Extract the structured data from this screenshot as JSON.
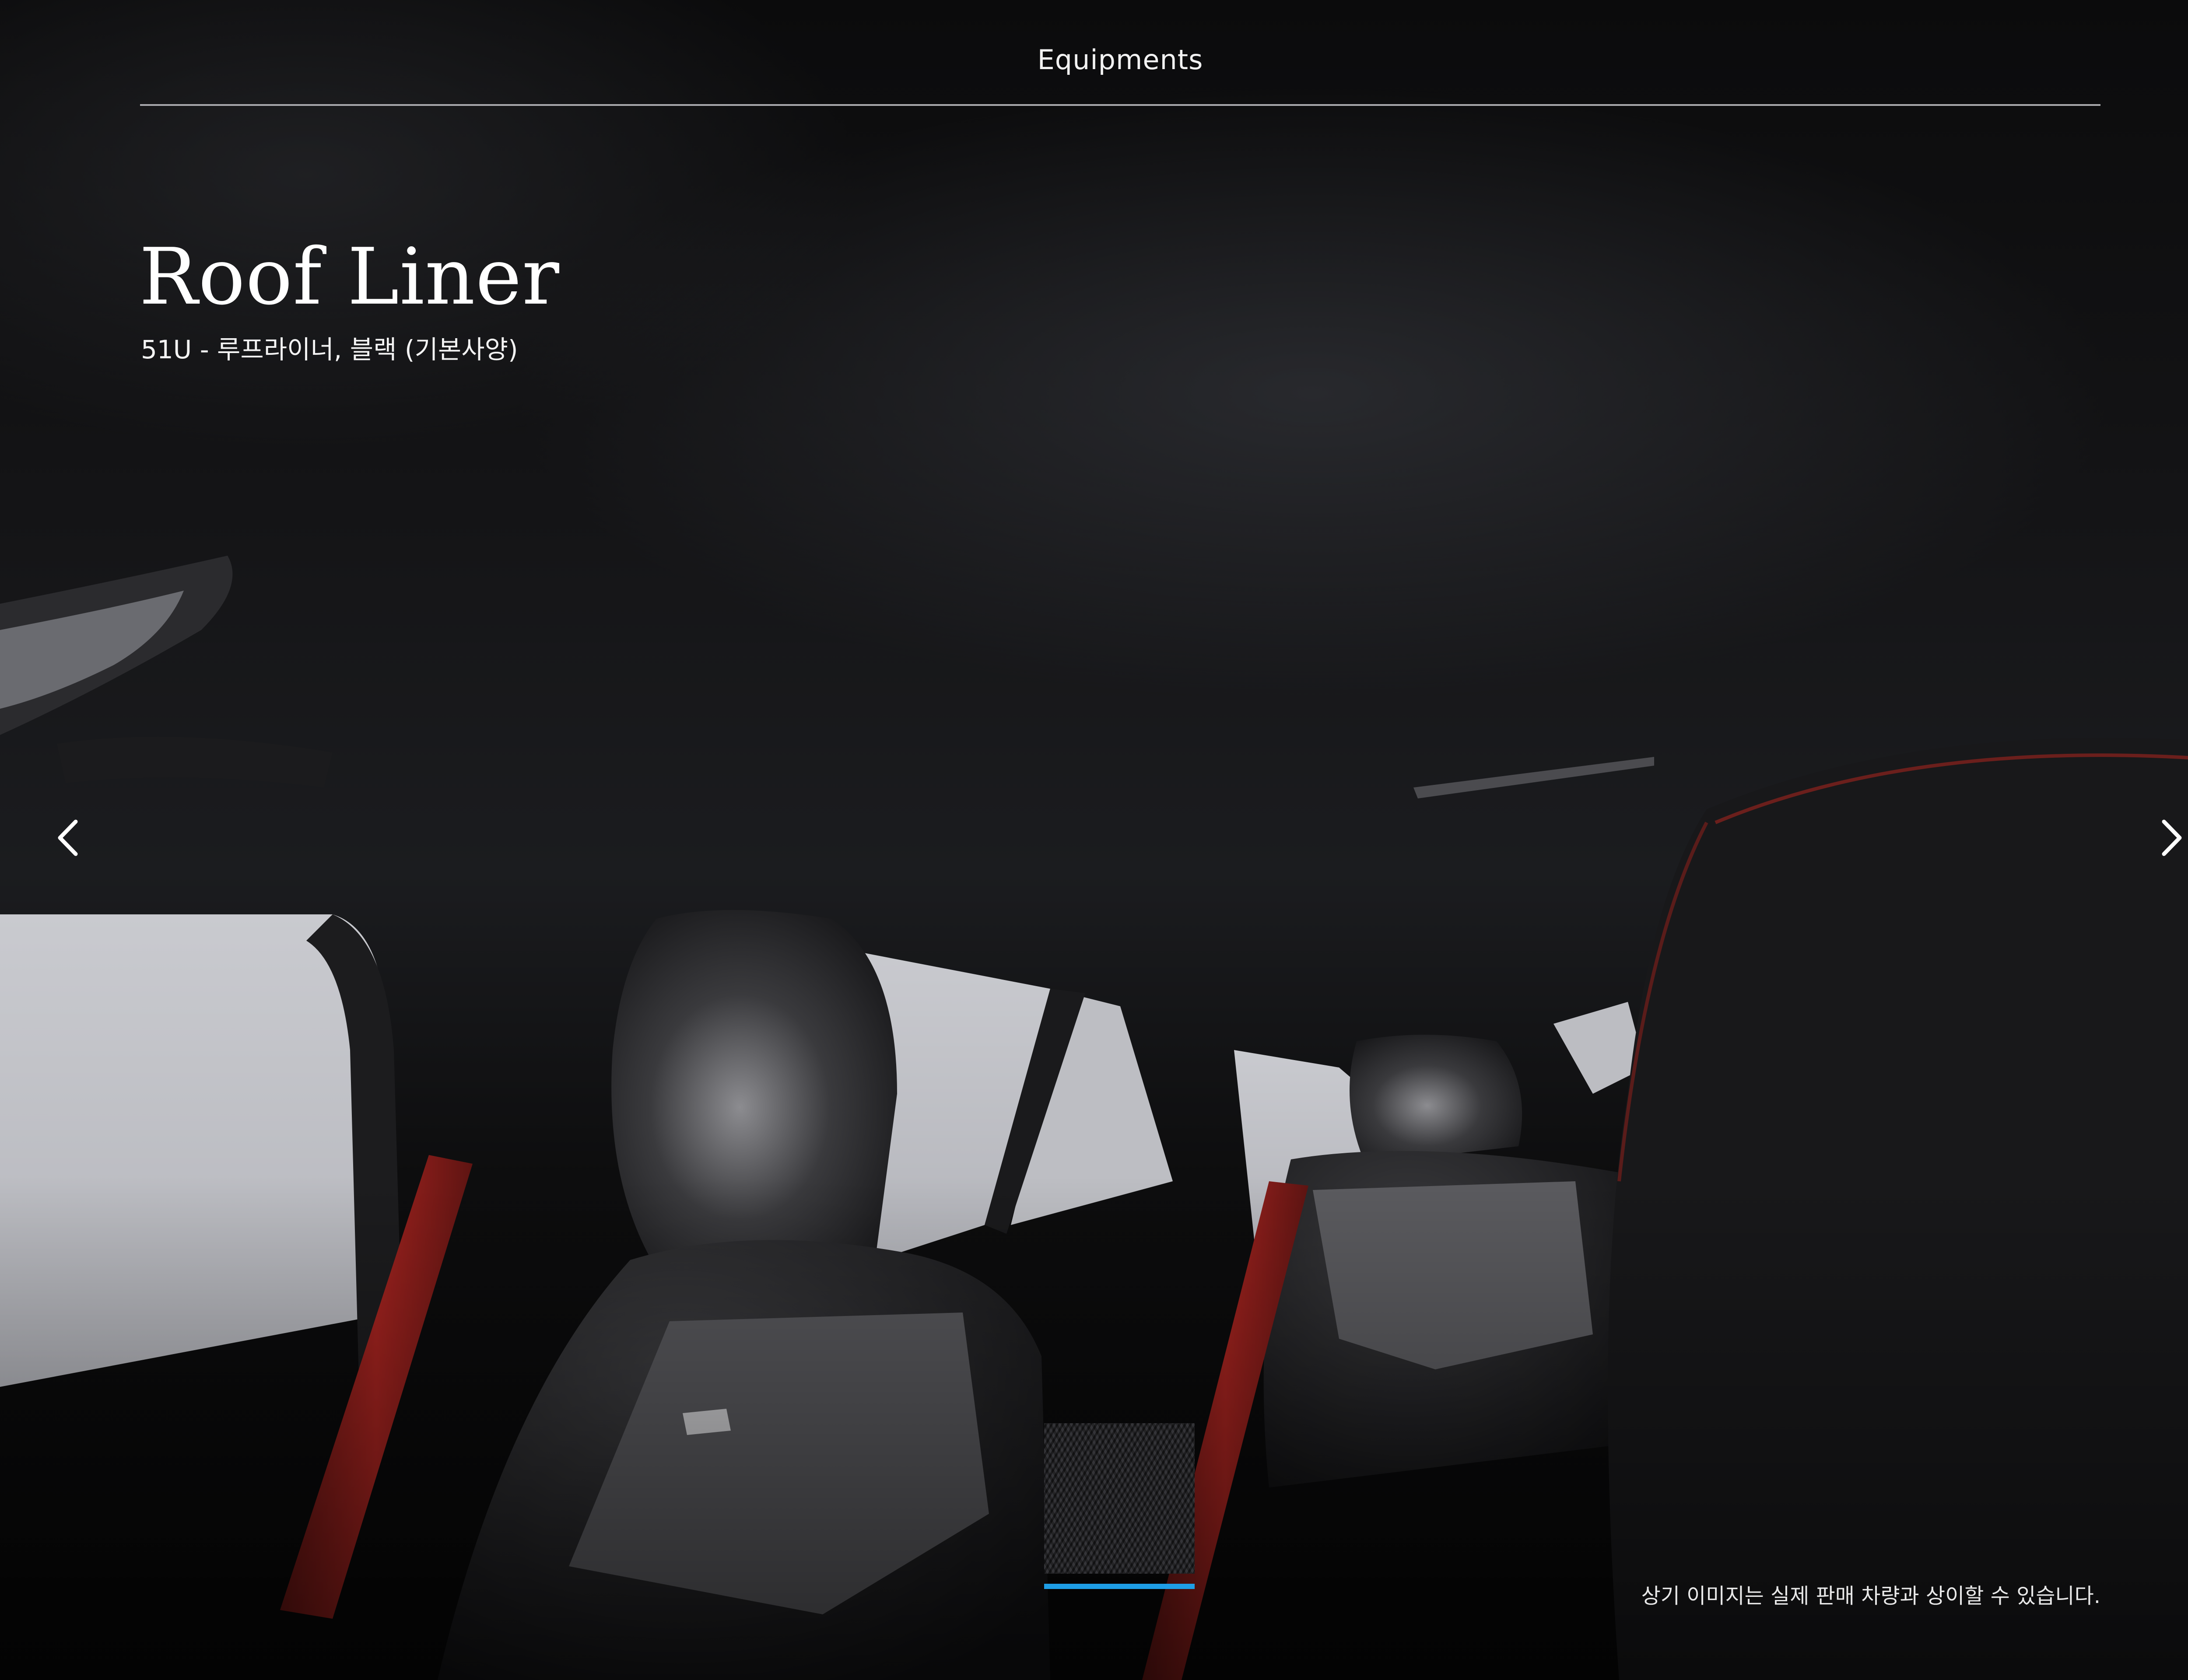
{
  "header": {
    "section_title": "Equipments"
  },
  "main": {
    "title": "Roof Liner",
    "option_code": "51U - 루프라이너, 블랙 (기본사양)",
    "disclaimer": "상기 이미지는 실제 판매 차량과 상이할 수 있습니다."
  },
  "carousel": {
    "prev_icon": "chevron-left-icon",
    "next_icon": "chevron-right-icon",
    "thumbnails": [
      {
        "name": "roof-liner-black-swatch",
        "selected": true
      }
    ],
    "indicator_color": "#1e9ee6"
  },
  "colors": {
    "background": "#0b0b0c",
    "text": "#ffffff",
    "rule": "#a9a9ad",
    "accent": "#1e9ee6",
    "seatbelt": "#8a1a18"
  }
}
